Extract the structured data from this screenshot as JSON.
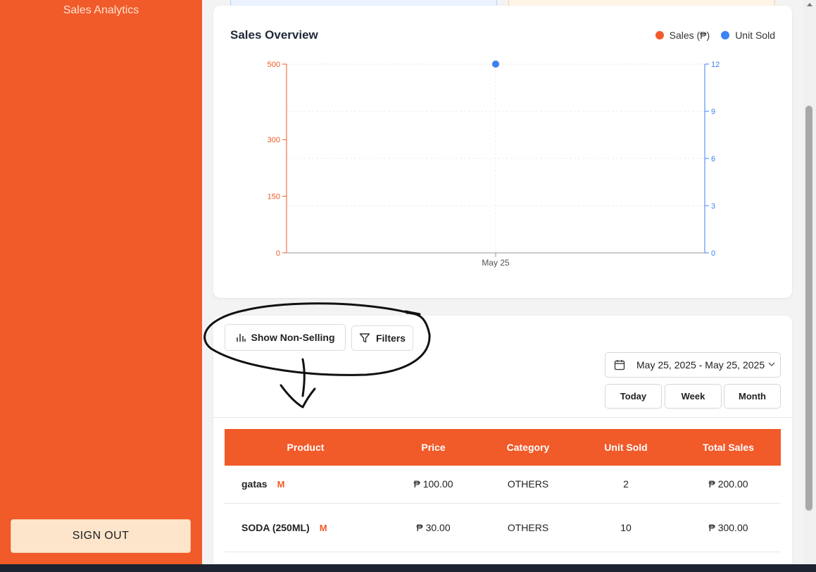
{
  "sidebar": {
    "nav_label": "Sales Analytics",
    "signout_label": "SIGN OUT"
  },
  "chart": {
    "title": "Sales Overview",
    "legend": [
      {
        "label": "Sales (₱)",
        "color": "#f15a29"
      },
      {
        "label": "Unit Sold",
        "color": "#3b82f6"
      }
    ]
  },
  "chart_data": {
    "type": "line",
    "title": "Sales Overview",
    "x": [
      "May 25"
    ],
    "series": [
      {
        "name": "Sales (₱)",
        "axis": "left",
        "color": "#f15a29",
        "values": [
          500
        ]
      },
      {
        "name": "Unit Sold",
        "axis": "right",
        "color": "#3b82f6",
        "values": [
          12
        ]
      }
    ],
    "y_left": {
      "ticks": [
        0,
        150,
        300,
        500
      ],
      "ylim": [
        0,
        500
      ],
      "color": "#f15a29"
    },
    "y_right": {
      "ticks": [
        0,
        3,
        6,
        9,
        12
      ],
      "ylim": [
        0,
        12
      ],
      "color": "#3b82f6"
    },
    "grid": true,
    "legend_position": "top-right"
  },
  "controls": {
    "show_nonselling_label": "Show Non-Selling",
    "filters_label": "Filters",
    "date_range": "May 25, 2025 - May 25, 2025",
    "period_buttons": [
      "Today",
      "Week",
      "Month"
    ]
  },
  "table": {
    "headers": [
      "Product",
      "Price",
      "Category",
      "Unit Sold",
      "Total Sales"
    ],
    "rows": [
      {
        "product": "gatas",
        "badge": "M",
        "price": "₱ 100.00",
        "category": "OTHERS",
        "units": "2",
        "total": "₱ 200.00"
      },
      {
        "product": "SODA (250ML)",
        "badge": "M",
        "price": "₱ 30.00",
        "category": "OTHERS",
        "units": "10",
        "total": "₱ 300.00"
      }
    ]
  }
}
